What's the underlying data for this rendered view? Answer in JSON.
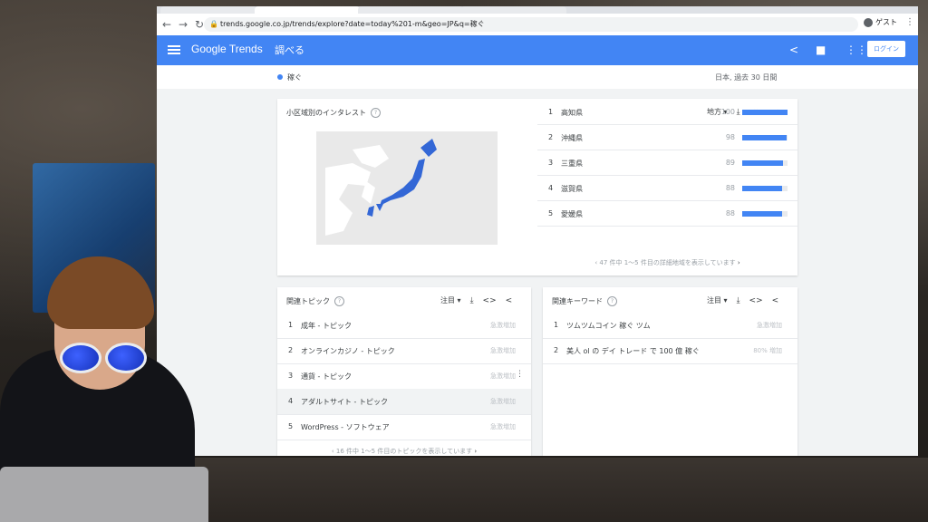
{
  "browser": {
    "tabs": [
      "",
      "",
      "",
      ""
    ],
    "url": "trends.google.co.jp/trends/explore?date=today%201-m&geo=JP&q=稼ぐ",
    "profile_label": "ゲスト"
  },
  "header": {
    "logo": "Google Trends",
    "explore_label": "調べる",
    "login_label": "ログイン",
    "brand_color": "#4285f4"
  },
  "subbar": {
    "term": "稼ぐ",
    "filters": "日本, 過去 30 日間"
  },
  "region": {
    "title": "小区域別のインタレスト",
    "resolution_label": "地方",
    "rows": [
      {
        "rank": "1",
        "name": "高知県",
        "value": 100
      },
      {
        "rank": "2",
        "name": "沖縄県",
        "value": 98
      },
      {
        "rank": "3",
        "name": "三重県",
        "value": 89
      },
      {
        "rank": "4",
        "name": "滋賀県",
        "value": 88
      },
      {
        "rank": "5",
        "name": "愛媛県",
        "value": 88
      }
    ],
    "pager": "47 件中 1～5 件目の詳細地域を表示しています"
  },
  "topics": {
    "title": "関連トピック",
    "sort_label": "注目",
    "rows": [
      {
        "rank": "1",
        "name": "成年 - トピック",
        "value": "急激増加"
      },
      {
        "rank": "2",
        "name": "オンラインカジノ - トピック",
        "value": "急激増加"
      },
      {
        "rank": "3",
        "name": "通貨 - トピック",
        "value": "急激増加"
      },
      {
        "rank": "4",
        "name": "アダルトサイト - トピック",
        "value": "急激増加"
      },
      {
        "rank": "5",
        "name": "WordPress - ソフトウェア",
        "value": "急激増加"
      }
    ],
    "pager": "16 件中 1～5 件目のトピックを表示しています"
  },
  "queries": {
    "title": "関連キーワード",
    "sort_label": "注目",
    "rows": [
      {
        "rank": "1",
        "name": "ツムツムコイン 稼ぐ ツム",
        "value": "急激増加"
      },
      {
        "rank": "2",
        "name": "美人 ol の デイ トレード で 100 億 稼ぐ",
        "value": "80% 増加"
      }
    ]
  }
}
